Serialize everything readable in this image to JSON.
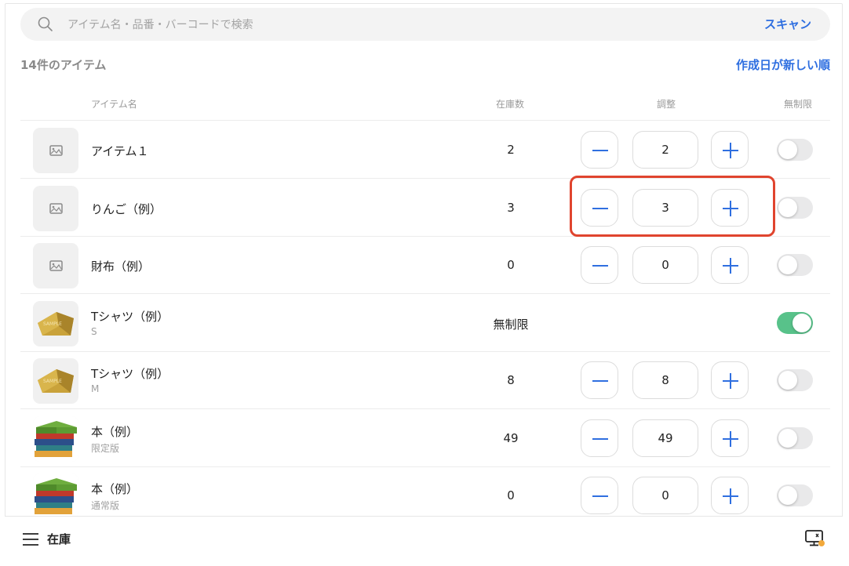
{
  "search": {
    "placeholder": "アイテム名・品番・バーコードで検索",
    "scan_label": "スキャン"
  },
  "summary": {
    "count_label": "14件のアイテム",
    "sort_label": "作成日が新しい順"
  },
  "columns": {
    "name": "アイテム名",
    "stock": "在庫数",
    "adjust": "調整",
    "unlimited": "無制限"
  },
  "items": [
    {
      "name": "アイテム１",
      "sub": "",
      "stock": "2",
      "adjust": "2",
      "unlimited": false,
      "thumb": "placeholder-image-icon"
    },
    {
      "name": "りんご（例）",
      "sub": "",
      "stock": "3",
      "adjust": "3",
      "unlimited": false,
      "thumb": "placeholder-image-icon"
    },
    {
      "name": "財布（例）",
      "sub": "",
      "stock": "0",
      "adjust": "0",
      "unlimited": false,
      "thumb": "placeholder-image-icon"
    },
    {
      "name": "Tシャツ（例）",
      "sub": "S",
      "stock": "無制限",
      "adjust": "",
      "unlimited": true,
      "thumb": "tshirt-sample-image"
    },
    {
      "name": "Tシャツ（例）",
      "sub": "M",
      "stock": "8",
      "adjust": "8",
      "unlimited": false,
      "thumb": "tshirt-sample-image"
    },
    {
      "name": "本（例）",
      "sub": "限定版",
      "stock": "49",
      "adjust": "49",
      "unlimited": false,
      "thumb": "books-image"
    },
    {
      "name": "本（例）",
      "sub": "通常版",
      "stock": "0",
      "adjust": "0",
      "unlimited": false,
      "thumb": "books-image"
    }
  ],
  "bottom_bar": {
    "title": "在庫"
  },
  "colors": {
    "accent": "#2f6fe0",
    "toggle_on": "#58c28a",
    "highlight": "#e0442e"
  }
}
